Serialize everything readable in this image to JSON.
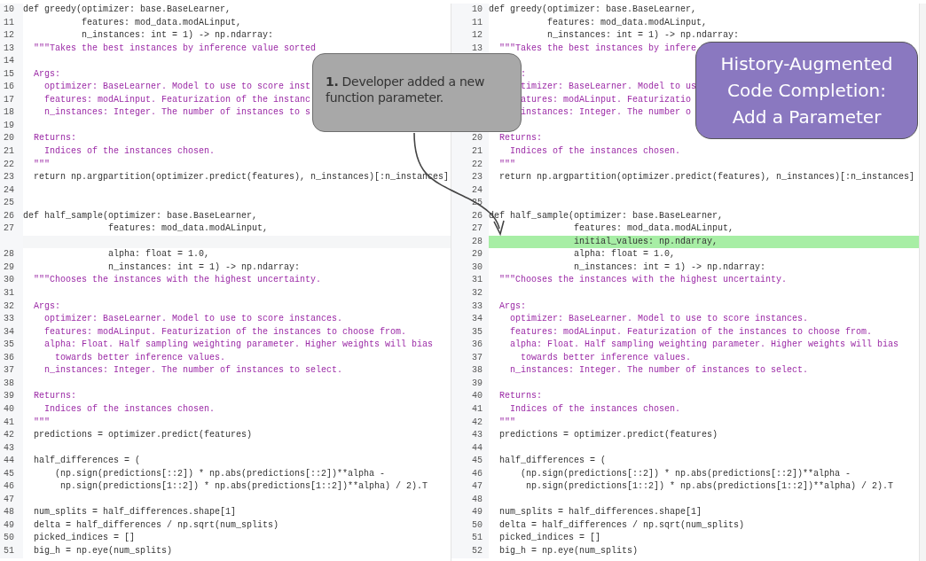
{
  "panes": [
    {
      "lines": [
        {
          "number": "10",
          "kind": "code",
          "text": "def greedy(optimizer: base.BaseLearner,"
        },
        {
          "number": "11",
          "kind": "code",
          "text": "           features: mod_data.modALinput,"
        },
        {
          "number": "12",
          "kind": "code",
          "text": "           n_instances: int = 1) -> np.ndarray:"
        },
        {
          "number": "13",
          "kind": "doc",
          "text": "  \"\"\"Takes the best instances by inference value sorted"
        },
        {
          "number": "14",
          "kind": "code"
        },
        {
          "number": "15",
          "kind": "doc",
          "text": "  Args:"
        },
        {
          "number": "16",
          "kind": "doc",
          "text": "    optimizer: BaseLearner. Model to use to score inst"
        },
        {
          "number": "17",
          "kind": "doc",
          "text": "    features: modALinput. Featurization of the instanc"
        },
        {
          "number": "18",
          "kind": "doc",
          "text": "    n_instances: Integer. The number of instances to s"
        },
        {
          "number": "19",
          "kind": "code"
        },
        {
          "number": "20",
          "kind": "doc",
          "text": "  Returns:"
        },
        {
          "number": "21",
          "kind": "doc",
          "text": "    Indices of the instances chosen."
        },
        {
          "number": "22",
          "kind": "doc",
          "text": "  \"\"\""
        },
        {
          "number": "23",
          "kind": "code",
          "text": "  return np.argpartition(optimizer.predict(features), n_instances)[:n_instances]"
        },
        {
          "number": "24",
          "kind": "code"
        },
        {
          "number": "25",
          "kind": "code"
        },
        {
          "number": "26",
          "kind": "code",
          "text": "def half_sample(optimizer: base.BaseLearner,"
        },
        {
          "number": "27",
          "kind": "code",
          "text": "                features: mod_data.modALinput,"
        },
        {
          "kind": "filler"
        },
        {
          "number": "28",
          "kind": "code",
          "text": "                alpha: float = 1.0,"
        },
        {
          "number": "29",
          "kind": "code",
          "text": "                n_instances: int = 1) -> np.ndarray:"
        },
        {
          "number": "30",
          "kind": "doc",
          "text": "  \"\"\"Chooses the instances with the highest uncertainty."
        },
        {
          "number": "31",
          "kind": "code"
        },
        {
          "number": "32",
          "kind": "doc",
          "text": "  Args:"
        },
        {
          "number": "33",
          "kind": "doc",
          "text": "    optimizer: BaseLearner. Model to use to score instances."
        },
        {
          "number": "34",
          "kind": "doc",
          "text": "    features: modALinput. Featurization of the instances to choose from."
        },
        {
          "number": "35",
          "kind": "doc",
          "text": "    alpha: Float. Half sampling weighting parameter. Higher weights will bias"
        },
        {
          "number": "36",
          "kind": "doc",
          "text": "      towards better inference values."
        },
        {
          "number": "37",
          "kind": "doc",
          "text": "    n_instances: Integer. The number of instances to select."
        },
        {
          "number": "38",
          "kind": "code"
        },
        {
          "number": "39",
          "kind": "doc",
          "text": "  Returns:"
        },
        {
          "number": "40",
          "kind": "doc",
          "text": "    Indices of the instances chosen."
        },
        {
          "number": "41",
          "kind": "doc",
          "text": "  \"\"\""
        },
        {
          "number": "42",
          "kind": "code",
          "text": "  predictions = optimizer.predict(features)"
        },
        {
          "number": "43",
          "kind": "code"
        },
        {
          "number": "44",
          "kind": "code",
          "text": "  half_differences = ("
        },
        {
          "number": "45",
          "kind": "code",
          "text": "      (np.sign(predictions[::2]) * np.abs(predictions[::2])**alpha -"
        },
        {
          "number": "46",
          "kind": "code",
          "text": "       np.sign(predictions[1::2]) * np.abs(predictions[1::2])**alpha) / 2).T"
        },
        {
          "number": "47",
          "kind": "code"
        },
        {
          "number": "48",
          "kind": "code",
          "text": "  num_splits = half_differences.shape[1]"
        },
        {
          "number": "49",
          "kind": "code",
          "text": "  delta = half_differences / np.sqrt(num_splits)"
        },
        {
          "number": "50",
          "kind": "code",
          "text": "  picked_indices = []"
        },
        {
          "number": "51",
          "kind": "code",
          "text": "  big_h = np.eye(num_splits)"
        }
      ]
    },
    {
      "lines": [
        {
          "number": "10",
          "kind": "code",
          "text": "def greedy(optimizer: base.BaseLearner,"
        },
        {
          "number": "11",
          "kind": "code",
          "text": "           features: mod_data.modALinput,"
        },
        {
          "number": "12",
          "kind": "code",
          "text": "           n_instances: int = 1) -> np.ndarray:"
        },
        {
          "number": "13",
          "kind": "doc",
          "text": "  \"\"\"Takes the best instances by infere"
        },
        {
          "kind": "code"
        },
        {
          "kind": "doc",
          "text": "      :"
        },
        {
          "kind": "doc",
          "text": "      timizer: BaseLearner. Model to us"
        },
        {
          "kind": "doc",
          "text": "      atures: modALinput. Featurizatio"
        },
        {
          "kind": "doc",
          "text": "      instances: Integer. The number o"
        },
        {
          "kind": "code"
        },
        {
          "number": "20",
          "kind": "doc",
          "text": "  Returns:"
        },
        {
          "number": "21",
          "kind": "doc",
          "text": "    Indices of the instances chosen."
        },
        {
          "number": "22",
          "kind": "doc",
          "text": "  \"\"\""
        },
        {
          "number": "23",
          "kind": "code",
          "text": "  return np.argpartition(optimizer.predict(features), n_instances)[:n_instances]"
        },
        {
          "number": "24",
          "kind": "code"
        },
        {
          "number": "25",
          "kind": "code"
        },
        {
          "number": "26",
          "kind": "code",
          "text": "def half_sample(optimizer: base.BaseLearner,"
        },
        {
          "number": "27",
          "kind": "code",
          "text": "                features: mod_data.modALinput,"
        },
        {
          "number": "28",
          "kind": "added",
          "text": "                initial_values: np.ndarray,"
        },
        {
          "number": "29",
          "kind": "code",
          "text": "                alpha: float = 1.0,"
        },
        {
          "number": "30",
          "kind": "code",
          "text": "                n_instances: int = 1) -> np.ndarray:"
        },
        {
          "number": "31",
          "kind": "doc",
          "text": "  \"\"\"Chooses the instances with the highest uncertainty."
        },
        {
          "number": "32",
          "kind": "code"
        },
        {
          "number": "33",
          "kind": "doc",
          "text": "  Args:"
        },
        {
          "number": "34",
          "kind": "doc",
          "text": "    optimizer: BaseLearner. Model to use to score instances."
        },
        {
          "number": "35",
          "kind": "doc",
          "text": "    features: modALinput. Featurization of the instances to choose from."
        },
        {
          "number": "36",
          "kind": "doc",
          "text": "    alpha: Float. Half sampling weighting parameter. Higher weights will bias"
        },
        {
          "number": "37",
          "kind": "doc",
          "text": "      towards better inference values."
        },
        {
          "number": "38",
          "kind": "doc",
          "text": "    n_instances: Integer. The number of instances to select."
        },
        {
          "number": "39",
          "kind": "code"
        },
        {
          "number": "40",
          "kind": "doc",
          "text": "  Returns:"
        },
        {
          "number": "41",
          "kind": "doc",
          "text": "    Indices of the instances chosen."
        },
        {
          "number": "42",
          "kind": "doc",
          "text": "  \"\"\""
        },
        {
          "number": "43",
          "kind": "code",
          "text": "  predictions = optimizer.predict(features)"
        },
        {
          "number": "44",
          "kind": "code"
        },
        {
          "number": "45",
          "kind": "code",
          "text": "  half_differences = ("
        },
        {
          "number": "46",
          "kind": "code",
          "text": "      (np.sign(predictions[::2]) * np.abs(predictions[::2])**alpha -"
        },
        {
          "number": "47",
          "kind": "code",
          "text": "       np.sign(predictions[1::2]) * np.abs(predictions[1::2])**alpha) / 2).T"
        },
        {
          "number": "48",
          "kind": "code"
        },
        {
          "number": "49",
          "kind": "code",
          "text": "  num_splits = half_differences.shape[1]"
        },
        {
          "number": "50",
          "kind": "code",
          "text": "  delta = half_differences / np.sqrt(num_splits)"
        },
        {
          "number": "51",
          "kind": "code",
          "text": "  picked_indices = []"
        },
        {
          "number": "52",
          "kind": "code",
          "text": "  big_h = np.eye(num_splits)"
        }
      ]
    }
  ],
  "callout": {
    "text": "**1.** Developer added a new function parameter."
  },
  "title_card": {
    "text": "History-Augmented Code Completion: Add a Parameter"
  }
}
